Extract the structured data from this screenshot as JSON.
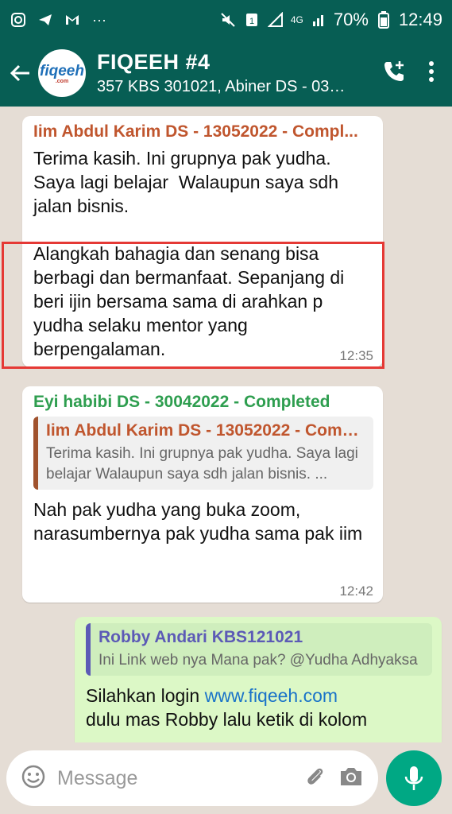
{
  "status": {
    "battery": "70%",
    "time": "12:49",
    "network": "4G"
  },
  "header": {
    "title": "FIQEEH #4",
    "subtitle": "357 KBS 301021, Abiner DS - 030...",
    "avatar_text": "fiqeeh",
    "avatar_sub": ".com"
  },
  "messages": [
    {
      "sender": "Iim Abdul Karim DS - 13052022 - Compl...",
      "text1": "Terima kasih. Ini grupnya pak yudha. Saya lagi belajar  Walaupun saya sdh jalan bisnis.",
      "text2": "Alangkah bahagia dan senang bisa berbagi dan bermanfaat. Sepanjang di beri ijin bersama sama di arahkan p yudha selaku mentor yang berpengalaman.",
      "time": "12:35"
    },
    {
      "sender": "Eyi habibi DS - 30042022 - Completed",
      "quote_sender": "Iim Abdul Karim DS - 13052022 - Comp...",
      "quote_text": "Terima kasih. Ini grupnya pak yudha. Saya lagi belajar  Walaupun saya sdh jalan bisnis. ...",
      "text": "Nah pak yudha yang buka zoom, narasumbernya pak yudha sama pak iim",
      "time": "12:42"
    },
    {
      "quote_sender": "Robby Andari KBS121021",
      "quote_text": "Ini Link web nya Mana pak? @Yudha Adhyaksa",
      "text_prefix": "Silahkan login ",
      "link": "www.fiqeeh.com",
      "text_cont": "dulu mas Robby lalu ketik di kolom"
    }
  ],
  "input": {
    "placeholder": "Message"
  },
  "colors": {
    "header": "#075e54",
    "sender1": "#c0562e",
    "sender2": "#2e9e4f",
    "quote_sender3": "#5c5ab6",
    "highlight": "#e53935",
    "mic": "#00a884"
  }
}
